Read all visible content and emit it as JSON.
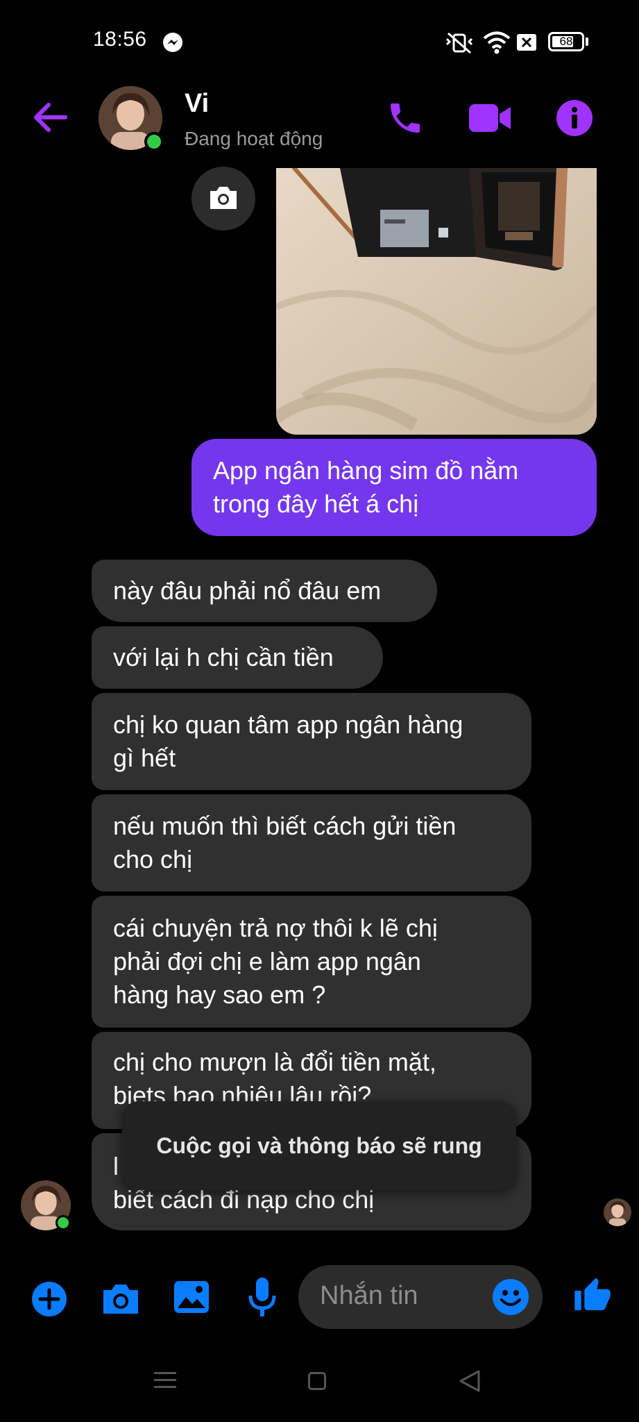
{
  "status_bar": {
    "time": "18:56",
    "battery": "68",
    "icons": [
      "messenger-icon",
      "vibrate-off-icon",
      "wifi-icon",
      "sim-icon",
      "battery-icon"
    ]
  },
  "header": {
    "back_icon": "back-arrow-icon",
    "contact_name": "Vi",
    "contact_status": "Đang hoạt động",
    "actions": [
      "phone-icon",
      "video-icon",
      "info-icon"
    ]
  },
  "conversation": {
    "image_message": {
      "overlay_icon": "camera-icon"
    },
    "sent": [
      {
        "text": "App ngân hàng sim đồ nằm\ntrong đây hết á chị"
      }
    ],
    "received": [
      {
        "text": "này đâu phải nổ đâu em"
      },
      {
        "text": "với lại h chị cần tiền"
      },
      {
        "text": "chị ko quan tâm app ngân hàng\ngì hết"
      },
      {
        "text": "nếu muốn thì biết cách gửi tiền\ncho chị"
      },
      {
        "text": "cái chuyện trả nợ thôi k lẽ chị\nphải đợi chị e làm app ngân\nhàng hay sao em ?"
      },
      {
        "text": "chị cho mượn là đổi tiền mặt,\nbiets bao nhiêu lâu rồi?"
      },
      {
        "text": "l\nbiết cách đi nạp cho chị"
      }
    ]
  },
  "toast": {
    "text": "Cuộc gọi và thông báo sẽ rung"
  },
  "composer": {
    "placeholder": "Nhắn tin",
    "buttons": [
      "plus-icon",
      "camera-icon",
      "gallery-icon",
      "microphone-icon",
      "emoji-icon",
      "thumbs-up-icon"
    ]
  },
  "colors": {
    "accent": "#a033ff",
    "sent_bubble": "#7537ee",
    "received_bubble": "#303030",
    "messenger_blue": "#0a7cff",
    "online": "#31cc46"
  }
}
